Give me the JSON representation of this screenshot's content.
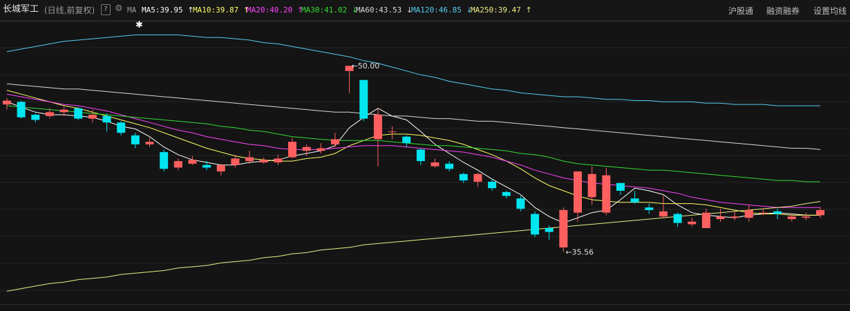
{
  "header": {
    "title": "长城军工",
    "period": "(日线,前复权)",
    "help": "?",
    "ma_label": "MA",
    "indicators": [
      {
        "text": "MA5:39.95",
        "arrow": "↑",
        "color": "#ffffff"
      },
      {
        "text": "MA10:39.87",
        "arrow": "↑",
        "color": "#ffff66"
      },
      {
        "text": "MA20:40.20",
        "arrow": "↑",
        "color": "#ff44ff"
      },
      {
        "text": "MA30:41.02",
        "arrow": "↓",
        "color": "#33dd33"
      },
      {
        "text": "MA60:43.53",
        "arrow": "↓",
        "color": "#d8d8d8"
      },
      {
        "text": "MA120:46.85",
        "arrow": "↓",
        "color": "#55ccee"
      },
      {
        "text": "MA250:39.47",
        "arrow": "↑",
        "color": "#eeee88"
      }
    ],
    "right_buttons": [
      "沪股通",
      "融资融券",
      "设置均线"
    ]
  },
  "chart_data": {
    "type": "candlestick",
    "ylim": [
      31.5,
      53.5
    ],
    "max_label": "50.00",
    "min_label": "35.56",
    "up_color": "#ff5f5f",
    "down_color": "#00e5f0",
    "candles": [
      [
        47.0,
        47.3,
        47.5,
        46.6
      ],
      [
        47.2,
        46.0,
        47.3,
        45.9
      ],
      [
        46.2,
        45.8,
        46.3,
        45.6
      ],
      [
        46.1,
        46.4,
        46.7,
        45.9
      ],
      [
        46.4,
        46.6,
        46.8,
        46.1
      ],
      [
        46.7,
        45.9,
        46.8,
        45.8
      ],
      [
        45.9,
        46.2,
        46.6,
        45.6
      ],
      [
        46.1,
        45.6,
        46.3,
        44.9
      ],
      [
        45.6,
        44.8,
        45.7,
        44.6
      ],
      [
        44.6,
        43.9,
        44.8,
        43.6
      ],
      [
        43.9,
        44.1,
        44.4,
        43.7
      ],
      [
        43.3,
        42.0,
        43.5,
        41.8
      ],
      [
        42.1,
        42.6,
        42.8,
        41.9
      ],
      [
        42.4,
        42.7,
        43.0,
        42.3
      ],
      [
        42.3,
        42.1,
        42.6,
        41.9
      ],
      [
        41.8,
        42.3,
        42.4,
        41.5
      ],
      [
        42.3,
        42.8,
        43.1,
        42.1
      ],
      [
        42.6,
        42.9,
        43.4,
        42.4
      ],
      [
        42.5,
        42.7,
        42.9,
        42.4
      ],
      [
        42.5,
        42.8,
        43.1,
        42.3
      ],
      [
        42.9,
        44.1,
        44.4,
        42.8
      ],
      [
        43.4,
        43.7,
        43.9,
        43.0
      ],
      [
        43.4,
        43.6,
        44.0,
        43.2
      ],
      [
        43.9,
        44.3,
        44.8,
        43.7
      ],
      [
        49.6,
        50.0,
        50.0,
        47.9
      ],
      [
        48.9,
        45.9,
        48.9,
        45.7
      ],
      [
        44.3,
        46.2,
        46.7,
        42.2
      ],
      [
        44.9,
        44.9,
        45.3,
        44.3
      ],
      [
        44.5,
        44.0,
        44.6,
        43.7
      ],
      [
        43.5,
        42.6,
        43.6,
        42.3
      ],
      [
        42.2,
        42.5,
        42.8,
        42.1
      ],
      [
        42.4,
        42.0,
        42.6,
        41.8
      ],
      [
        41.6,
        41.1,
        41.7,
        40.9
      ],
      [
        41.0,
        41.6,
        41.7,
        40.6
      ],
      [
        41.0,
        40.5,
        41.2,
        40.3
      ],
      [
        40.2,
        39.9,
        40.3,
        39.7
      ],
      [
        39.7,
        38.9,
        39.9,
        38.7
      ],
      [
        38.5,
        36.9,
        38.7,
        36.7
      ],
      [
        37.4,
        37.1,
        37.6,
        36.5
      ],
      [
        35.9,
        38.8,
        39.0,
        35.56
      ],
      [
        38.6,
        41.8,
        41.8,
        37.9
      ],
      [
        39.8,
        41.6,
        42.2,
        39.2
      ],
      [
        38.6,
        41.5,
        42.1,
        38.4
      ],
      [
        40.9,
        40.3,
        40.9,
        40.0
      ],
      [
        39.7,
        39.4,
        40.3,
        39.3
      ],
      [
        39.0,
        38.8,
        39.3,
        38.5
      ],
      [
        38.3,
        38.7,
        39.9,
        38.2
      ],
      [
        38.5,
        37.8,
        38.6,
        37.5
      ],
      [
        37.7,
        37.9,
        38.2,
        37.5
      ],
      [
        37.4,
        38.6,
        38.9,
        37.4
      ],
      [
        38.1,
        38.3,
        38.9,
        37.9
      ],
      [
        38.2,
        38.3,
        38.7,
        38.0
      ],
      [
        38.2,
        38.8,
        39.2,
        37.9
      ],
      [
        38.6,
        38.6,
        38.9,
        38.4
      ],
      [
        38.7,
        38.5,
        38.9,
        38.1
      ],
      [
        38.1,
        38.3,
        38.5,
        37.9
      ],
      [
        38.2,
        38.3,
        38.6,
        38.0
      ],
      [
        38.4,
        38.8,
        39.0,
        38.2
      ]
    ],
    "ma_lines": [
      {
        "name": "MA5",
        "color": "#ffffff",
        "values": [
          47.2,
          46.8,
          46.4,
          46.2,
          46.2,
          46.1,
          46.0,
          45.7,
          45.3,
          45.1,
          44.5,
          43.7,
          43.1,
          42.7,
          42.5,
          42.3,
          42.3,
          42.5,
          42.6,
          42.7,
          43.0,
          43.2,
          43.4,
          43.8,
          45.2,
          46.0,
          46.7,
          46.1,
          45.8,
          44.9,
          43.9,
          43.2,
          42.5,
          41.9,
          41.2,
          40.6,
          40.0,
          39.0,
          38.3,
          37.8,
          38.2,
          38.6,
          38.8,
          39.6,
          40.5,
          40.3,
          40.0,
          39.2,
          38.6,
          38.4,
          38.3,
          38.2,
          38.4,
          38.5,
          38.6,
          38.5,
          38.4,
          38.4
        ]
      },
      {
        "name": "MA10",
        "color": "#ffff66",
        "values": [
          48.1,
          47.8,
          47.5,
          47.2,
          46.9,
          46.7,
          46.4,
          46.1,
          45.8,
          45.5,
          45.2,
          44.8,
          44.4,
          44.0,
          43.6,
          43.3,
          43.0,
          42.8,
          42.7,
          42.6,
          42.6,
          42.8,
          42.9,
          43.2,
          43.8,
          44.2,
          44.6,
          44.7,
          44.7,
          44.6,
          44.4,
          44.2,
          43.9,
          43.5,
          43.1,
          42.6,
          42.0,
          41.3,
          40.7,
          40.3,
          39.9,
          39.6,
          39.5,
          39.4,
          39.4,
          39.4,
          39.3,
          39.3,
          39.3,
          39.2,
          39.0,
          38.8,
          38.6,
          38.5,
          38.5,
          38.4,
          38.4,
          38.4
        ]
      },
      {
        "name": "MA20",
        "color": "#ff44ff",
        "values": [
          47.8,
          47.6,
          47.4,
          47.2,
          47.0,
          46.9,
          46.7,
          46.5,
          46.2,
          45.9,
          45.6,
          45.3,
          45.0,
          44.8,
          44.5,
          44.3,
          44.1,
          43.9,
          43.8,
          43.6,
          43.5,
          43.5,
          43.5,
          43.6,
          43.7,
          43.8,
          43.8,
          43.8,
          43.7,
          43.6,
          43.5,
          43.4,
          43.3,
          43.1,
          42.9,
          42.6,
          42.3,
          41.9,
          41.6,
          41.3,
          41.1,
          40.9,
          40.8,
          40.7,
          40.6,
          40.5,
          40.3,
          40.1,
          39.8,
          39.6,
          39.4,
          39.3,
          39.2,
          39.1,
          39.0,
          39.0,
          39.0,
          39.0
        ]
      },
      {
        "name": "MA30",
        "color": "#33dd33",
        "values": [
          46.9,
          46.8,
          46.7,
          46.6,
          46.5,
          46.4,
          46.3,
          46.2,
          46.1,
          46.0,
          45.9,
          45.8,
          45.7,
          45.6,
          45.5,
          45.3,
          45.2,
          45.0,
          44.9,
          44.7,
          44.5,
          44.4,
          44.3,
          44.2,
          44.2,
          44.2,
          44.2,
          44.1,
          44.0,
          43.9,
          43.8,
          43.8,
          43.7,
          43.6,
          43.5,
          43.4,
          43.2,
          43.1,
          42.9,
          42.6,
          42.4,
          42.3,
          42.2,
          42.1,
          42.0,
          41.9,
          41.9,
          41.8,
          41.7,
          41.6,
          41.5,
          41.4,
          41.3,
          41.2,
          41.1,
          41.1,
          41.0,
          41.0
        ]
      },
      {
        "name": "MA60",
        "color": "#d8d8d8",
        "values": [
          48.6,
          48.5,
          48.4,
          48.3,
          48.2,
          48.2,
          48.1,
          48.0,
          47.9,
          47.8,
          47.7,
          47.6,
          47.5,
          47.4,
          47.3,
          47.2,
          47.1,
          47.0,
          46.9,
          46.8,
          46.7,
          46.6,
          46.5,
          46.4,
          46.4,
          46.3,
          46.2,
          46.1,
          46.1,
          46.0,
          45.9,
          45.9,
          45.8,
          45.7,
          45.7,
          45.6,
          45.5,
          45.4,
          45.3,
          45.2,
          45.1,
          45.0,
          44.9,
          44.8,
          44.7,
          44.6,
          44.5,
          44.4,
          44.3,
          44.2,
          44.1,
          44.0,
          43.9,
          43.8,
          43.7,
          43.6,
          43.6,
          43.5
        ]
      },
      {
        "name": "MA120",
        "color": "#55ccee",
        "values": [
          51.1,
          51.3,
          51.5,
          51.7,
          51.9,
          52.0,
          52.1,
          52.2,
          52.3,
          52.4,
          52.4,
          52.4,
          52.4,
          52.3,
          52.2,
          52.2,
          52.1,
          52.0,
          51.8,
          51.7,
          51.5,
          51.3,
          51.1,
          50.9,
          50.7,
          50.4,
          50.2,
          49.9,
          49.6,
          49.3,
          49.1,
          48.8,
          48.6,
          48.4,
          48.2,
          48.1,
          47.9,
          47.8,
          47.7,
          47.6,
          47.6,
          47.5,
          47.4,
          47.4,
          47.3,
          47.3,
          47.2,
          47.2,
          47.2,
          47.1,
          47.1,
          47.0,
          47.0,
          47.0,
          46.9,
          46.9,
          46.9,
          46.9
        ]
      },
      {
        "name": "MA250",
        "color": "#eeee88",
        "values": [
          32.5,
          32.7,
          32.9,
          33.1,
          33.2,
          33.4,
          33.5,
          33.6,
          33.8,
          33.9,
          34.0,
          34.1,
          34.3,
          34.4,
          34.5,
          34.7,
          34.8,
          34.9,
          35.1,
          35.2,
          35.4,
          35.5,
          35.7,
          35.8,
          35.9,
          36.1,
          36.2,
          36.3,
          36.4,
          36.5,
          36.6,
          36.7,
          36.8,
          36.9,
          37.0,
          37.1,
          37.2,
          37.3,
          37.4,
          37.5,
          37.6,
          37.7,
          37.8,
          37.9,
          38.0,
          38.1,
          38.2,
          38.3,
          38.4,
          38.5,
          38.6,
          38.7,
          38.8,
          38.9,
          39.0,
          39.1,
          39.3,
          39.47
        ]
      }
    ]
  }
}
